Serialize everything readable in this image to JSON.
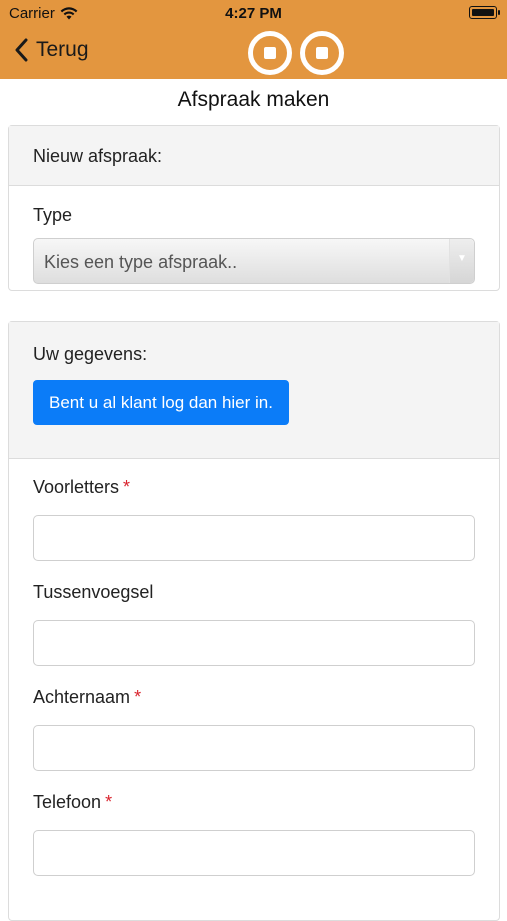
{
  "status_bar": {
    "carrier": "Carrier",
    "time": "4:27 PM"
  },
  "nav": {
    "back_label": "Terug"
  },
  "page": {
    "title": "Afspraak maken"
  },
  "appointment_card": {
    "header": "Nieuw afspraak:",
    "type_label": "Type",
    "type_select_value": "Kies een type afspraak.."
  },
  "details_card": {
    "header": "Uw gegevens:",
    "login_button": "Bent u al klant log dan hier in.",
    "fields": [
      {
        "label": "Voorletters",
        "required": "*"
      },
      {
        "label": "Tussenvoegsel",
        "required": ""
      },
      {
        "label": "Achternaam",
        "required": "*"
      },
      {
        "label": "Telefoon",
        "required": "*"
      }
    ]
  },
  "colors": {
    "brand_orange": "#e3963f",
    "primary_blue": "#0b7cf8",
    "required_red": "#d9232d"
  },
  "icons": {
    "wifi": "wifi-icon",
    "battery": "battery-icon",
    "back": "chevron-left-icon",
    "logo": "logo-icon"
  }
}
